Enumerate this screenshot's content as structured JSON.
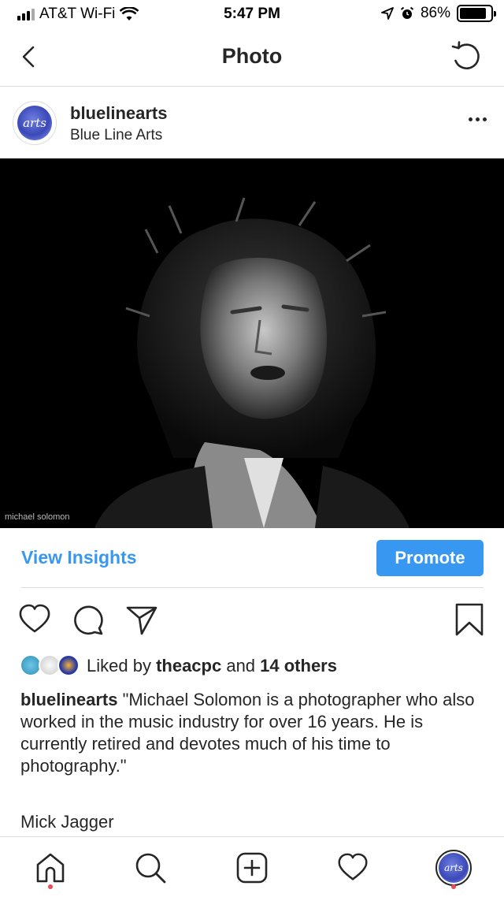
{
  "status_bar": {
    "carrier": "AT&T Wi-Fi",
    "time": "5:47 PM",
    "battery": "86%",
    "battery_level": 0.86
  },
  "nav": {
    "title": "Photo",
    "back_icon": "chevron-left-icon",
    "refresh_icon": "refresh-icon"
  },
  "post": {
    "username": "bluelinearts",
    "full_name": "Blue Line Arts",
    "avatar_text": "arts",
    "photo_credit": "michael solomon"
  },
  "insights": {
    "link": "View Insights",
    "promote": "Promote"
  },
  "likes": {
    "prefix": "Liked by ",
    "user": "theacpc",
    "middle": " and ",
    "others": "14 others"
  },
  "caption": {
    "username": "bluelinearts",
    "text": " \"Michael Solomon is a photographer who also worked in the music industry for over 16 years. He is currently retired and devotes much of his time to photography.\"",
    "subtitle": "Mick Jagger"
  },
  "tabs": [
    {
      "name": "home",
      "icon": "home-icon"
    },
    {
      "name": "search",
      "icon": "search-icon"
    },
    {
      "name": "new-post",
      "icon": "plus-square-icon"
    },
    {
      "name": "activity",
      "icon": "heart-icon"
    },
    {
      "name": "profile",
      "icon": "avatar"
    }
  ],
  "colors": {
    "accent": "#3897f0",
    "text": "#262626",
    "notification_dot": "#ed4956"
  }
}
